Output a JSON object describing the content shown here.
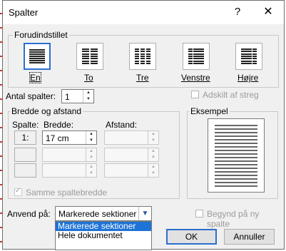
{
  "window": {
    "title": "Spalter",
    "help_glyph": "?",
    "close_glyph": "✕"
  },
  "presets": {
    "group_label": "Forudindstillet",
    "items": [
      {
        "label": "En",
        "icon": "one-column-icon"
      },
      {
        "label": "To",
        "icon": "two-columns-icon"
      },
      {
        "label": "Tre",
        "icon": "three-columns-icon"
      },
      {
        "label": "Venstre",
        "icon": "left-layout-icon"
      },
      {
        "label": "Højre",
        "icon": "right-layout-icon"
      }
    ],
    "selected": "En"
  },
  "columns": {
    "label": "Antal spalter:",
    "value": "1"
  },
  "line_between": {
    "label": "Adskilt af streg",
    "checked": false,
    "enabled": false
  },
  "width_spacing": {
    "group_label": "Bredde og afstand",
    "col_header": "Spalte:",
    "width_header": "Bredde:",
    "spacing_header": "Afstand:",
    "rows": [
      {
        "col": "1:",
        "width": "17 cm",
        "spacing": ""
      },
      {
        "col": "",
        "width": "",
        "spacing": ""
      },
      {
        "col": "",
        "width": "",
        "spacing": ""
      }
    ],
    "equal_width_label": "Samme spaltebredde",
    "equal_width_checked": true
  },
  "preview": {
    "group_label": "Eksempel"
  },
  "apply_to": {
    "label": "Anvend på:",
    "value": "Markerede sektioner",
    "options": [
      "Markerede sektioner",
      "Hele dokumentet"
    ],
    "highlighted": "Markerede sektioner"
  },
  "new_column": {
    "label": "Begynd på ny spalte",
    "checked": false,
    "enabled": false
  },
  "buttons": {
    "ok": "OK",
    "cancel": "Annuller"
  },
  "colors": {
    "accent": "#2a6fcf",
    "highlight": "#1e73d6",
    "disabled_text": "#9b9b9b"
  }
}
